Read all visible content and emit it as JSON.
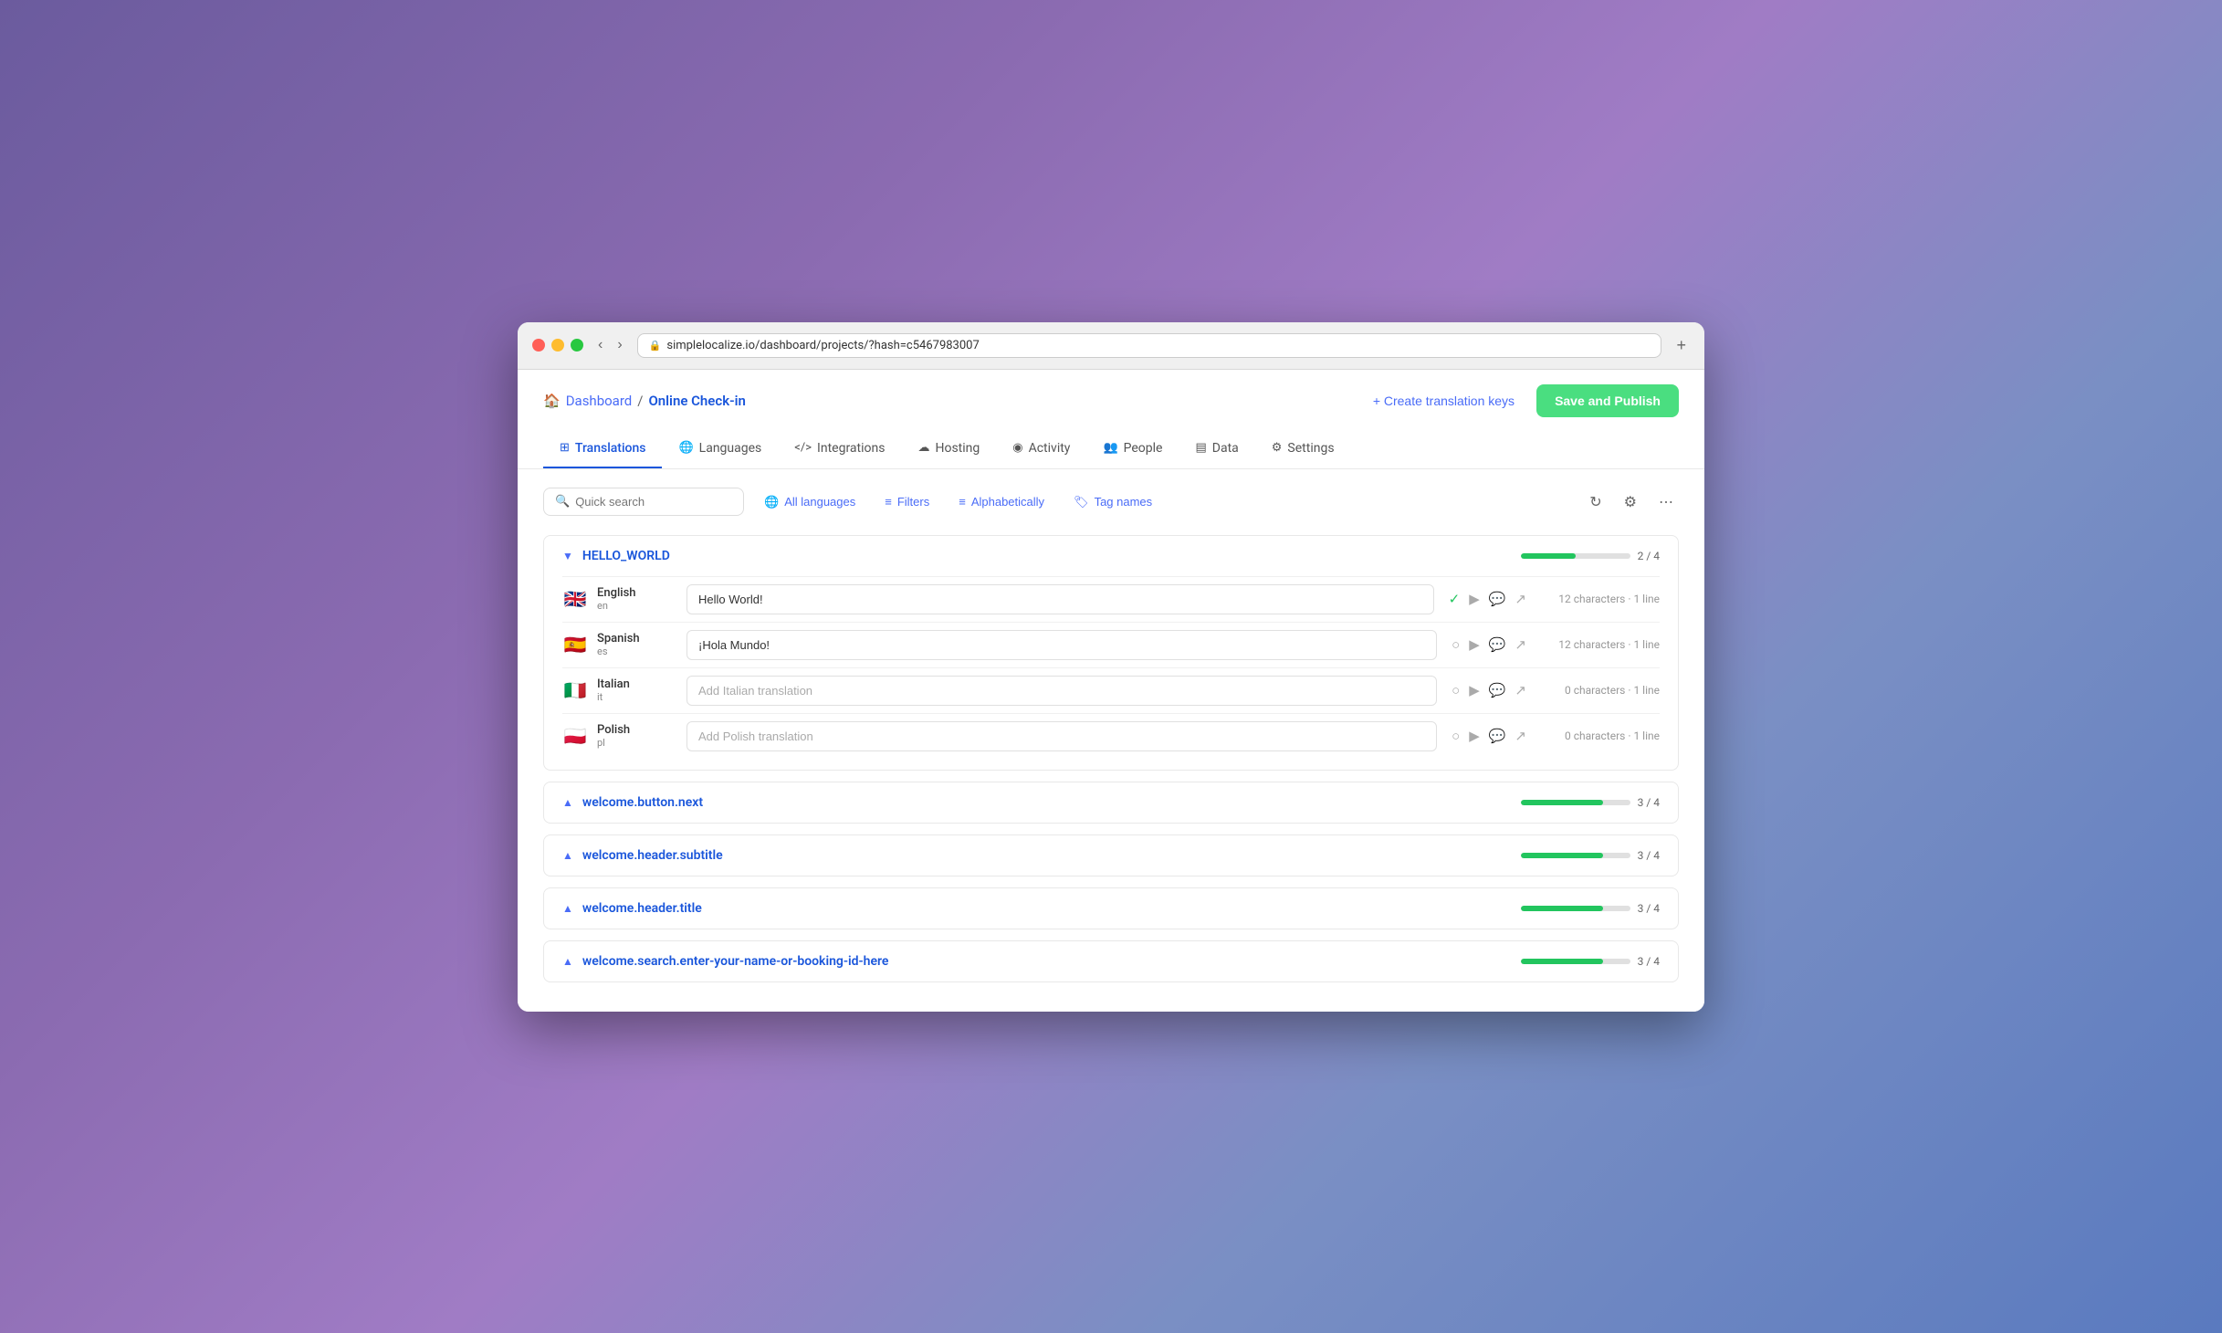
{
  "browser": {
    "url": "simplelocalize.io/dashboard/projects/?hash=c5467983007"
  },
  "breadcrumb": {
    "home_icon": "🏠",
    "dashboard": "Dashboard",
    "separator": "/",
    "current": "Online Check-in"
  },
  "header_actions": {
    "create_keys_label": "+ Create translation keys",
    "save_publish_label": "Save and Publish"
  },
  "tabs": [
    {
      "id": "translations",
      "label": "Translations",
      "icon": "⊞",
      "active": true
    },
    {
      "id": "languages",
      "label": "Languages",
      "icon": "🌐",
      "active": false
    },
    {
      "id": "integrations",
      "label": "Integrations",
      "icon": "</>",
      "active": false
    },
    {
      "id": "hosting",
      "label": "Hosting",
      "icon": "☁",
      "active": false
    },
    {
      "id": "activity",
      "label": "Activity",
      "icon": "◉",
      "active": false
    },
    {
      "id": "people",
      "label": "People",
      "icon": "👥",
      "active": false
    },
    {
      "id": "data",
      "label": "Data",
      "icon": "▤",
      "active": false
    },
    {
      "id": "settings",
      "label": "Settings",
      "icon": "⚙",
      "active": false
    }
  ],
  "toolbar": {
    "search_placeholder": "Quick search",
    "all_languages_label": "All languages",
    "filters_label": "Filters",
    "alphabetically_label": "Alphabetically",
    "tag_names_label": "Tag names"
  },
  "translation_groups": [
    {
      "key": "HELLO_WORLD",
      "expanded": true,
      "progress": 50,
      "progress_text": "2 / 4",
      "languages": [
        {
          "name": "English",
          "code": "en",
          "flag": "gb",
          "value": "Hello World!",
          "placeholder": "",
          "chars": "12 characters",
          "lines": "1 line",
          "approved": true
        },
        {
          "name": "Spanish",
          "code": "es",
          "flag": "es",
          "value": "¡Hola Mundo!",
          "placeholder": "",
          "chars": "12 characters",
          "lines": "1 line",
          "approved": false
        },
        {
          "name": "Italian",
          "code": "it",
          "flag": "it",
          "value": "",
          "placeholder": "Add Italian translation",
          "chars": "0 characters",
          "lines": "1 line",
          "approved": false
        },
        {
          "name": "Polish",
          "code": "pl",
          "flag": "pl",
          "value": "",
          "placeholder": "Add Polish translation",
          "chars": "0 characters",
          "lines": "1 line",
          "approved": false
        }
      ]
    },
    {
      "key": "welcome.button.next",
      "expanded": false,
      "progress": 75,
      "progress_text": "3 / 4"
    },
    {
      "key": "welcome.header.subtitle",
      "expanded": false,
      "progress": 75,
      "progress_text": "3 / 4"
    },
    {
      "key": "welcome.header.title",
      "expanded": false,
      "progress": 75,
      "progress_text": "3 / 4"
    },
    {
      "key": "welcome.search.enter-your-name-or-booking-id-here",
      "expanded": false,
      "progress": 75,
      "progress_text": "3 / 4"
    }
  ]
}
